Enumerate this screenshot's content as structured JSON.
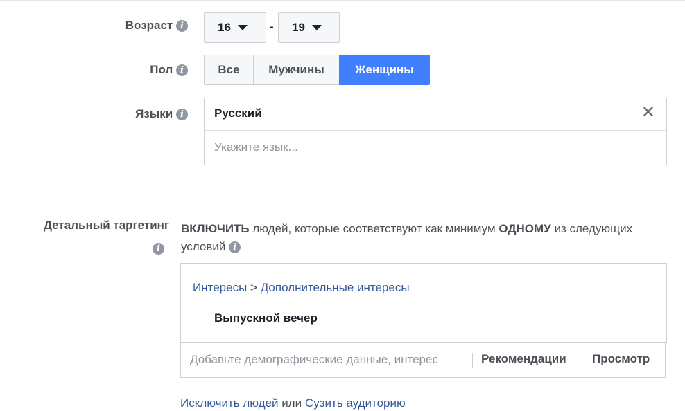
{
  "age": {
    "label": "Возраст",
    "min": "16",
    "separator": "-",
    "max": "19"
  },
  "gender": {
    "label": "Пол",
    "options": [
      "Все",
      "Мужчины",
      "Женщины"
    ],
    "selected": "Женщины",
    "accent_color": "#4080ff"
  },
  "languages": {
    "label": "Языки",
    "selected": "Русский",
    "remove_icon": "close-icon",
    "placeholder": "Укажите язык..."
  },
  "detailed_targeting": {
    "label": "Детальный таргетинг",
    "include_prefix": "ВКЛЮЧИТЬ",
    "include_mid": " людей, которые соответствуют как минимум ",
    "include_bold": "ОДНОМУ",
    "include_suffix": " из следующих условий",
    "breadcrumb": {
      "parent": "Интересы",
      "separator": ">",
      "child": "Дополнительные интересы"
    },
    "interest": "Выпускной вечер",
    "search_placeholder": "Добавьте демографические данные, интерес",
    "recommendations": "Рекомендации",
    "browse": "Просмотр"
  },
  "footer": {
    "exclude_link": "Исключить людей",
    "or": "или",
    "narrow_link": "Сузить аудиторию"
  },
  "icons": {
    "info": "i"
  }
}
